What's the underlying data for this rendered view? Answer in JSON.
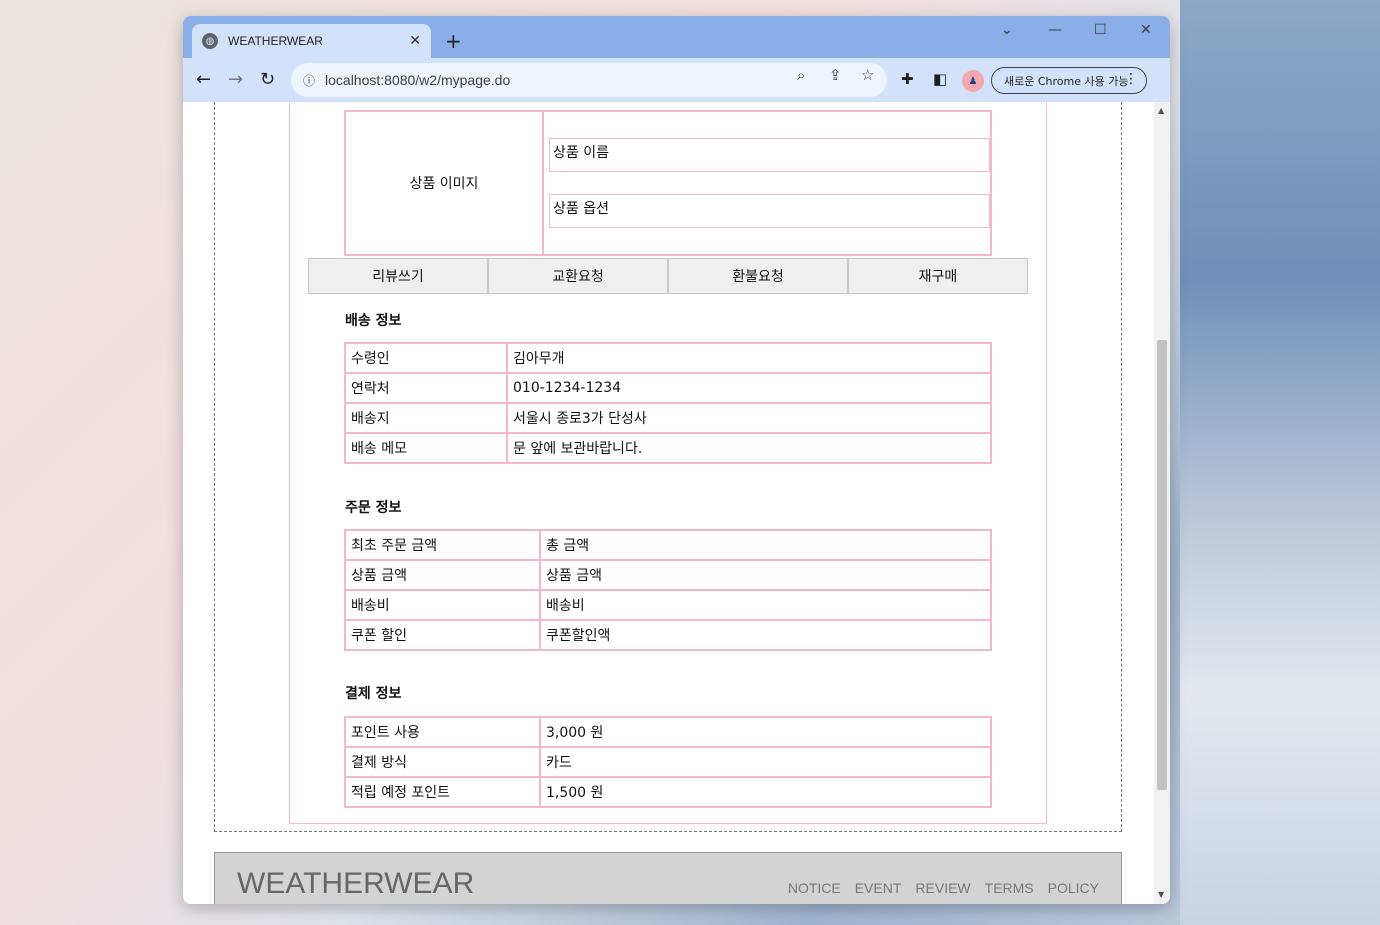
{
  "browser": {
    "tab_title": "WEATHERWEAR",
    "tab_close": "✕",
    "new_tab": "+",
    "url": "localhost:8080/w2/mypage.do",
    "chrome_pill": "새로운 Chrome 사용 가능",
    "profile_initial": "♟"
  },
  "product": {
    "image_label": "상품 이미지",
    "name_label": "상품 이름",
    "option_label": "상품 옵션"
  },
  "actions": [
    "리뷰쓰기",
    "교환요청",
    "환불요청",
    "재구매"
  ],
  "delivery": {
    "title": "배송 정보",
    "rows": [
      {
        "label": "수령인",
        "value": "김아무개"
      },
      {
        "label": "연락처",
        "value": "010-1234-1234"
      },
      {
        "label": "배송지",
        "value": "서울시 종로3가 단성사"
      },
      {
        "label": "배송 메모",
        "value": "문 앞에 보관바랍니다."
      }
    ]
  },
  "order": {
    "title": "주문 정보",
    "rows": [
      {
        "label": "최초 주문 금액",
        "value": "총 금액"
      },
      {
        "label": "상품 금액",
        "value": "상품 금액"
      },
      {
        "label": "배송비",
        "value": "배송비"
      },
      {
        "label": "쿠폰 할인",
        "value": "쿠폰할인액"
      }
    ]
  },
  "payment": {
    "title": "결제 정보",
    "rows": [
      {
        "label": "포인트 사용",
        "value": "3,000 원"
      },
      {
        "label": "결제 방식",
        "value": "카드"
      },
      {
        "label": "적립 예정 포인트",
        "value": "1,500 원"
      }
    ]
  },
  "footer": {
    "logo": "WEATHERWEAR",
    "links": [
      "NOTICE",
      "EVENT",
      "REVIEW",
      "TERMS",
      "POLICY"
    ]
  },
  "colors": {
    "table_border": "#f4b9c8",
    "tabbar": "#8aaee8",
    "toolbar": "#d3e2fb"
  }
}
